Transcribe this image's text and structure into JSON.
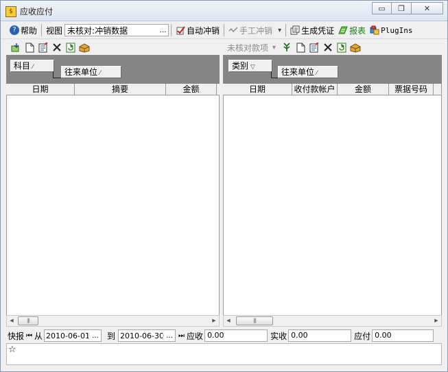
{
  "window": {
    "title": "应收应付",
    "app_icon": "app-icon",
    "buttons": {
      "minimize": "▭",
      "restore": "❐",
      "close": "✕"
    }
  },
  "toolbar": {
    "help_label": "帮助",
    "view_label": "视图",
    "view_value": "未核对:冲销数据",
    "ellipsis": "…",
    "auto_writeoff_label": "自动冲销",
    "manual_writeoff_label": "手工冲销",
    "dropdown_arrow": "▾",
    "voucher_label": "生成凭证",
    "report_label": "报表",
    "plugins_label": "PlugIns"
  },
  "left_panel": {
    "group_boxes": [
      "科目",
      "往来单位"
    ],
    "columns": [
      "日期",
      "摘要",
      "金额"
    ]
  },
  "right_panel": {
    "filter_label": "未核对款项",
    "group_boxes": [
      "类别",
      "往来单位"
    ],
    "columns": [
      "日期",
      "收付款帐户",
      "金额",
      "票据号码"
    ]
  },
  "statusbar": {
    "quick_report_label": "快报",
    "from_label": "从",
    "from_date": "2010-06-01",
    "to_label": "到",
    "to_date": "2010-06-30",
    "receivable_label": "应收",
    "receivable_value": "0.00",
    "actual_received_label": "实收",
    "actual_received_value": "0.00",
    "payable_label": "应付",
    "payable_value": "0.00"
  },
  "memo": {
    "marker": "☆"
  },
  "colors": {
    "group_area": "#858585",
    "window_bg": "#f0f0f0",
    "help_icon": "#2b5fb4",
    "report_text": "#1b7a1b"
  }
}
